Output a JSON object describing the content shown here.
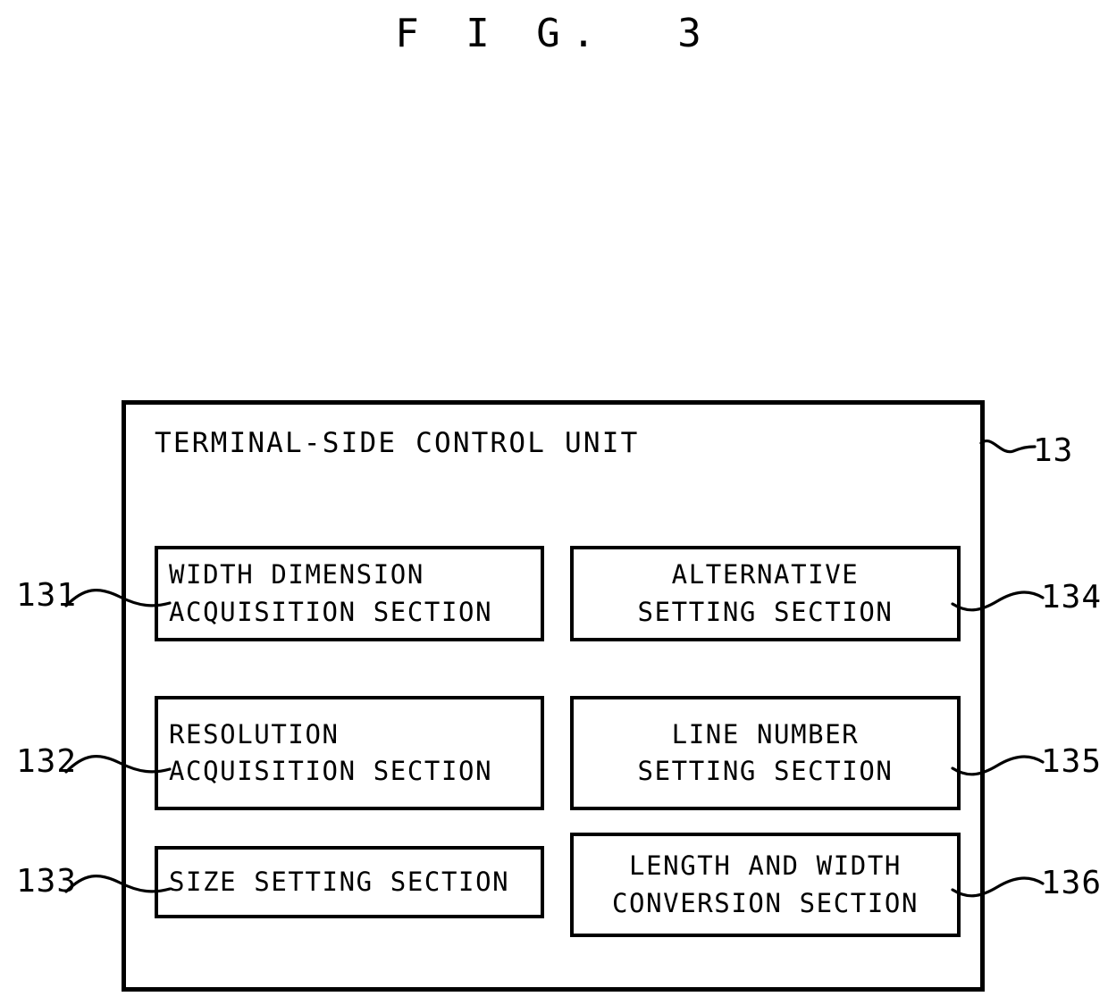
{
  "figure": {
    "title": "F I G.  3"
  },
  "outer": {
    "title": "TERMINAL-SIDE CONTROL UNIT",
    "ref": "13"
  },
  "modules": [
    {
      "id": "131",
      "ref": "131",
      "align": "left",
      "lines": [
        "WIDTH DIMENSION",
        "ACQUISITION SECTION"
      ]
    },
    {
      "id": "132",
      "ref": "132",
      "align": "left",
      "lines": [
        "RESOLUTION",
        "ACQUISITION SECTION"
      ]
    },
    {
      "id": "133",
      "ref": "133",
      "align": "left",
      "lines": [
        "SIZE SETTING SECTION"
      ]
    },
    {
      "id": "134",
      "ref": "134",
      "align": "center",
      "lines": [
        "ALTERNATIVE",
        "SETTING SECTION"
      ]
    },
    {
      "id": "135",
      "ref": "135",
      "align": "center",
      "lines": [
        "LINE NUMBER",
        "SETTING SECTION"
      ]
    },
    {
      "id": "136",
      "ref": "136",
      "align": "center",
      "lines": [
        "LENGTH AND WIDTH",
        "CONVERSION SECTION"
      ]
    }
  ],
  "colors": {
    "ink": "#000000",
    "paper": "#ffffff"
  }
}
